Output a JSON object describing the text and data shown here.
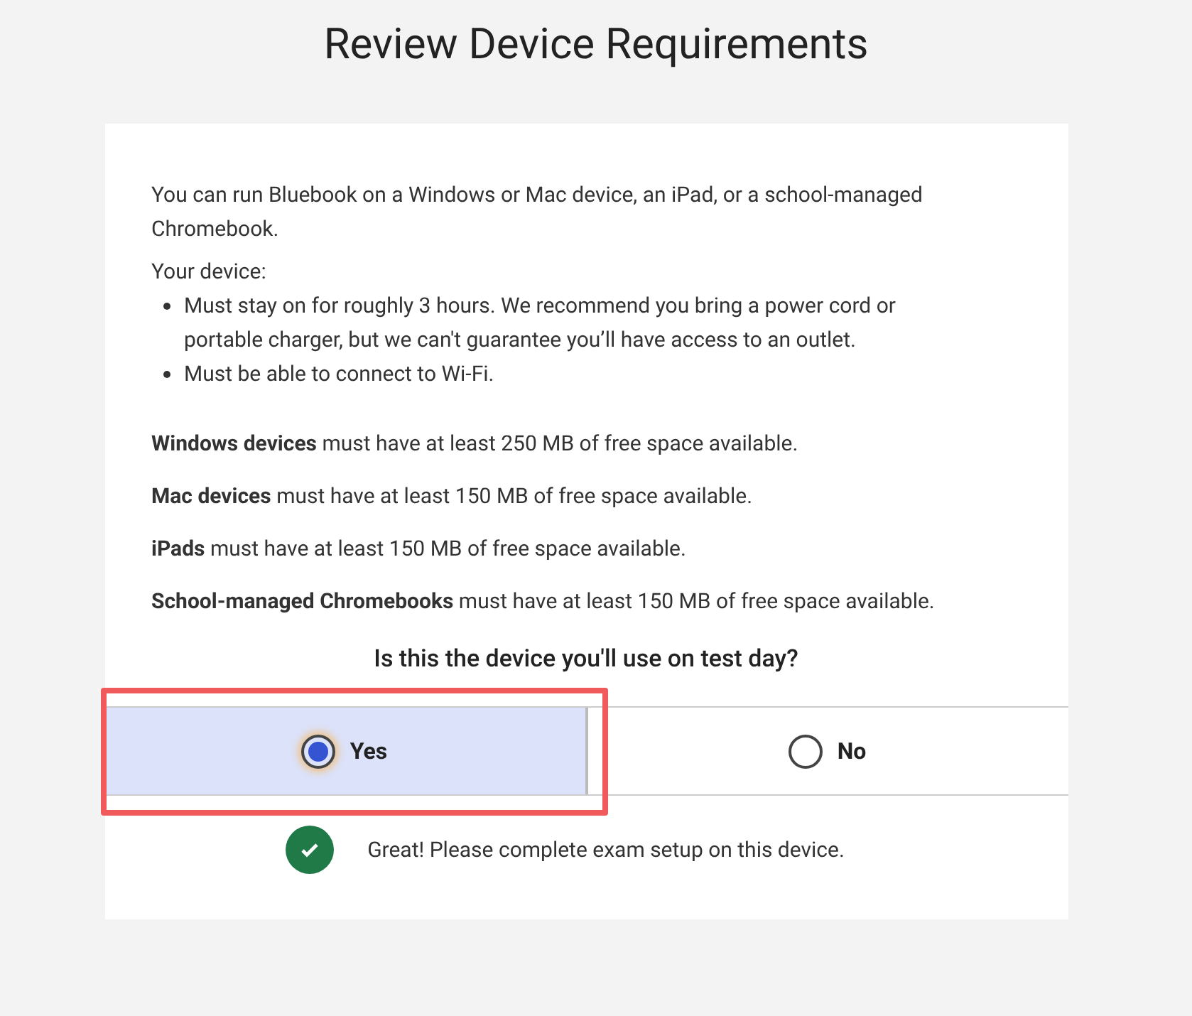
{
  "title": "Review Device Requirements",
  "intro": "You can run Bluebook on a Windows or Mac device, an iPad, or a school-managed Chromebook.",
  "device_heading": "Your device:",
  "device_items": [
    "Must stay on for roughly 3 hours. We recommend you bring a power cord or portable charger, but we can't guarantee you’ll have access to an outlet.",
    "Must be able to connect to Wi-Fi."
  ],
  "requirements": [
    "**Windows devices** must have at least 250 MB of free space available.",
    "**Mac devices** must have at least 150 MB of free space available.",
    "**iPads** must have at least 150 MB of free space available.",
    "**School-managed Chromebooks** must have at least 150 MB of free space available."
  ],
  "question": "Is this the device you'll use on test day?",
  "options": [
    {
      "label": "Yes",
      "selected": true,
      "highlighted": true
    },
    {
      "label": "No",
      "selected": false,
      "highlighted": false
    }
  ],
  "confirmation": "Great! Please complete exam setup on this device."
}
